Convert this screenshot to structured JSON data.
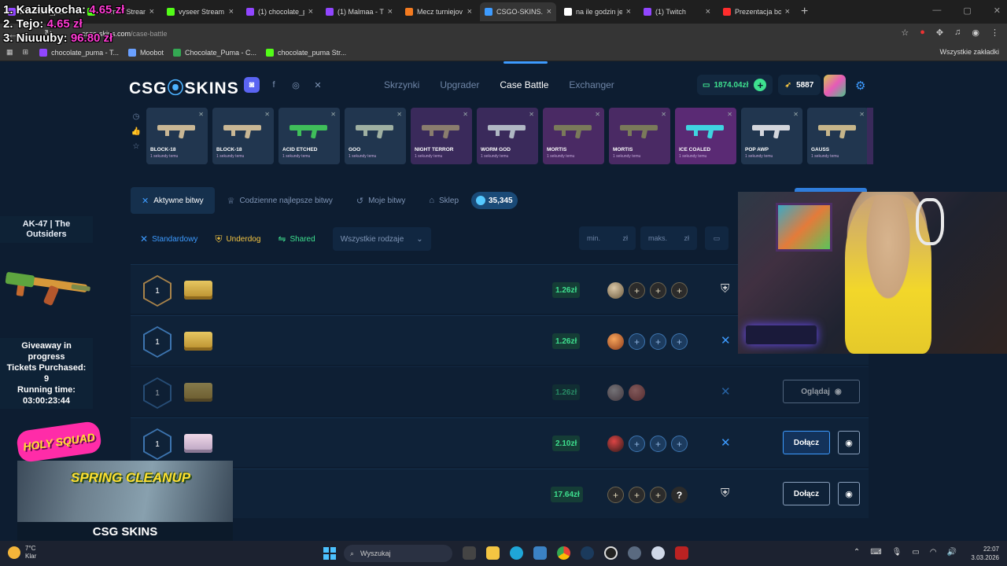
{
  "browser": {
    "tabs": [
      {
        "title": "chocolate_pum",
        "color": "#9146ff",
        "active": false
      },
      {
        "title": "Malmaa Stream",
        "color": "#53fc18",
        "active": false
      },
      {
        "title": "vyseer Stream",
        "color": "#53fc18",
        "active": false
      },
      {
        "title": "(1) chocolate_p",
        "color": "#9146ff",
        "active": false
      },
      {
        "title": "(1) Malmaa - T",
        "color": "#9146ff",
        "active": false
      },
      {
        "title": "Mecz turniejov",
        "color": "#f47b20",
        "active": false
      },
      {
        "title": "CSGO-SKINS.C",
        "color": "#3d9bff",
        "active": true
      },
      {
        "title": "na ile godzin je",
        "color": "#ffffff",
        "active": false
      },
      {
        "title": "(1) Twitch",
        "color": "#9146ff",
        "active": false
      },
      {
        "title": "Prezentacja bo",
        "color": "#ff2d2d",
        "active": false
      }
    ],
    "url_domain": "csgo-skins.com",
    "url_path": "/case-battle",
    "bookmarks": [
      {
        "label": "chocolate_puma - T...",
        "color": "#9146ff"
      },
      {
        "label": "Moobot",
        "color": "#6aa0ff"
      },
      {
        "label": "Chocolate_Puma - C...",
        "color": "#34a853"
      },
      {
        "label": "chocolate_puma Str...",
        "color": "#53fc18"
      }
    ],
    "bookmarks_right": "Wszystkie zakładki"
  },
  "overlay": {
    "lines": [
      {
        "rank": "1. Kaziukocha:",
        "amount": "4.65 zł"
      },
      {
        "rank": "2. Tejo:",
        "amount": "4.65 zł"
      },
      {
        "rank": "3. Niuuuby:",
        "amount": "96.80 zł"
      }
    ]
  },
  "header": {
    "logo_left": "CSG",
    "logo_right": "SKINS",
    "nav": [
      "Skrzynki",
      "Upgrader",
      "Case Battle",
      "Exchanger"
    ],
    "active_nav": "Case Battle",
    "balance": "1874.04zł",
    "coins": "5887"
  },
  "drops": [
    {
      "name": "BLOCK-18",
      "time": "1 sekundy temu",
      "bg": "#21364f",
      "gun": "#c9b795"
    },
    {
      "name": "BLOCK-18",
      "time": "1 sekundy temu",
      "bg": "#21364f",
      "gun": "#c9b795"
    },
    {
      "name": "ACID ETCHED",
      "time": "1 sekundy temu",
      "bg": "#21364f",
      "gun": "#3fbf5a"
    },
    {
      "name": "GOO",
      "time": "1 sekundy temu",
      "bg": "#21364f",
      "gun": "#9fb0a2"
    },
    {
      "name": "NIGHT TERROR",
      "time": "1 sekundy temu",
      "bg": "#3a2a5b",
      "gun": "#8a7d6e"
    },
    {
      "name": "WORM GOD",
      "time": "1 sekundy temu",
      "bg": "#3a2a5b",
      "gun": "#b0b8c4"
    },
    {
      "name": "MORTIS",
      "time": "1 sekundy temu",
      "bg": "#4a2a64",
      "gun": "#7a7a5a"
    },
    {
      "name": "MORTIS",
      "time": "1 sekundy temu",
      "bg": "#4a2a64",
      "gun": "#7a7a5a"
    },
    {
      "name": "ICE COALED",
      "time": "1 sekundy temu",
      "bg": "#5a2a74",
      "gun": "#3fd4e0"
    },
    {
      "name": "POP AWP",
      "time": "1 sekundy temu",
      "bg": "#21364f",
      "gun": "#d4d6dc"
    },
    {
      "name": "GAUSS",
      "time": "1 sekundy temu",
      "bg": "#21364f",
      "gun": "#c6b58a"
    }
  ],
  "subtabs": [
    {
      "label": "Aktywne bitwy",
      "icon": "✕",
      "active": true
    },
    {
      "label": "Codzienne najlepsze bitwy",
      "icon": "♕",
      "active": false
    },
    {
      "label": "Moje bitwy",
      "icon": "↺",
      "active": false
    },
    {
      "label": "Sklep",
      "icon": "⌂",
      "active": false
    }
  ],
  "gems": "35,345",
  "filters": {
    "standard": "Standardowy",
    "underdog": "Underdog",
    "shared": "Shared",
    "select": "Wszystkie rodzaje",
    "min_placeholder": "min.",
    "max_placeholder": "maks.",
    "currency": "zł"
  },
  "battles": [
    {
      "rounds": "1",
      "hex": "gold",
      "case": "gold",
      "price": "1.26zł",
      "slots": [
        "av1",
        "plus-gold",
        "plus-gold",
        "plus-gold"
      ],
      "mode": "underdog",
      "action": "",
      "dim": false
    },
    {
      "rounds": "1",
      "hex": "blue",
      "case": "gold",
      "price": "1.26zł",
      "slots": [
        "av2",
        "plus-slot",
        "plus-slot",
        "plus-slot"
      ],
      "mode": "standard",
      "action": "",
      "dim": false
    },
    {
      "rounds": "1",
      "hex": "blue",
      "case": "gold",
      "price": "1.26zł",
      "slots": [
        "av3",
        "av4"
      ],
      "mode": "standard",
      "action": "Oglądaj",
      "dim": true
    },
    {
      "rounds": "1",
      "hex": "blue",
      "case": "pink",
      "price": "2.10zł",
      "slots": [
        "av5",
        "plus-slot",
        "plus-slot",
        "plus-slot"
      ],
      "mode": "standard",
      "action": "Dołącz",
      "dim": false
    },
    {
      "rounds": "",
      "hex": "none",
      "case": "none",
      "price": "17.64zł",
      "slots": [
        "plus-gold",
        "plus-gold",
        "plus-gold",
        "q"
      ],
      "mode": "underdog",
      "action": "Dołącz",
      "dim": false
    }
  ],
  "giveaway": {
    "item_line1": "AK-47 | The",
    "item_line2": "Outsiders",
    "line1": "Giveaway in",
    "line2": "progress",
    "line3": "Tickets Purchased:",
    "line4": "9",
    "line5": "Running time:",
    "line6": "03:00:23:44"
  },
  "promo": {
    "badge": "HOLY SQUAD",
    "title": "SPRING CLEANUP",
    "brand": "CSG SKINS"
  },
  "taskbar": {
    "temp": "7°C",
    "cond": "Klar",
    "search": "Wyszukaj",
    "time": "22:07",
    "date": "3.03.2026"
  }
}
